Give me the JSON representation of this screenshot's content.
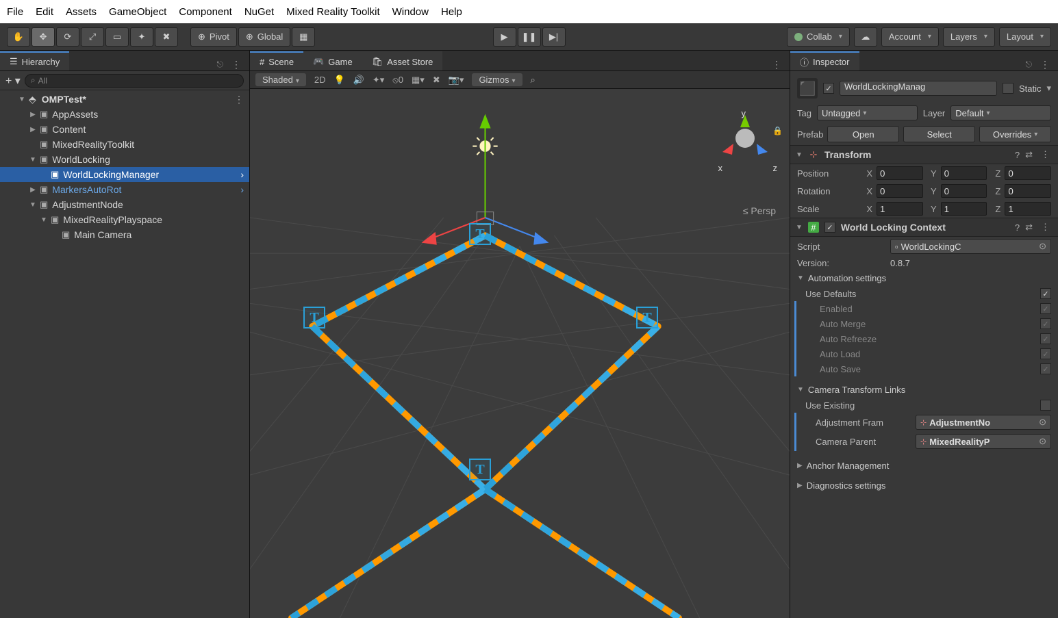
{
  "menubar": [
    "File",
    "Edit",
    "Assets",
    "GameObject",
    "Component",
    "NuGet",
    "Mixed Reality Toolkit",
    "Window",
    "Help"
  ],
  "toolbar": {
    "pivot": "Pivot",
    "global": "Global",
    "collab": "Collab",
    "account": "Account",
    "layers": "Layers",
    "layout": "Layout"
  },
  "hierarchy": {
    "title": "Hierarchy",
    "search_ph": "All",
    "scene": "OMPTest*",
    "items": {
      "appassets": "AppAssets",
      "content": "Content",
      "mrtk": "MixedRealityToolkit",
      "worldlocking": "WorldLocking",
      "wlm": "WorldLockingManager",
      "markers": "MarkersAutoRot",
      "adj": "AdjustmentNode",
      "playspace": "MixedRealityPlayspace",
      "camera": "Main Camera"
    }
  },
  "tabs": {
    "scene": "Scene",
    "game": "Game",
    "asset": "Asset Store",
    "inspector": "Inspector"
  },
  "scenebar": {
    "shaded": "Shaded",
    "twoD": "2D",
    "gizmos": "Gizmos"
  },
  "viewport": {
    "persp": "Persp",
    "x": "x",
    "y": "y",
    "z": "z"
  },
  "inspector": {
    "name": "WorldLockingManag",
    "static": "Static",
    "tag_l": "Tag",
    "tag_v": "Untagged",
    "layer_l": "Layer",
    "layer_v": "Default",
    "prefab_l": "Prefab",
    "open": "Open",
    "select": "Select",
    "overrides": "Overrides",
    "transform": {
      "title": "Transform",
      "position": "Position",
      "rotation": "Rotation",
      "scale": "Scale",
      "px": "0",
      "py": "0",
      "pz": "0",
      "rx": "0",
      "ry": "0",
      "rz": "0",
      "sx": "1",
      "sy": "1",
      "sz": "1",
      "X": "X",
      "Y": "Y",
      "Z": "Z"
    },
    "wlc": {
      "title": "World Locking Context",
      "script_l": "Script",
      "script_v": "WorldLockingC",
      "version_l": "Version:",
      "version_v": "0.8.7",
      "auto_h": "Automation settings",
      "use_defaults": "Use Defaults",
      "enabled": "Enabled",
      "auto_merge": "Auto Merge",
      "auto_refreeze": "Auto Refreeze",
      "auto_load": "Auto Load",
      "auto_save": "Auto Save",
      "cam_h": "Camera Transform Links",
      "use_existing": "Use Existing",
      "adj_l": "Adjustment Fram",
      "adj_v": "AdjustmentNo",
      "cam_l": "Camera Parent",
      "cam_v": "MixedRealityP",
      "anchor_h": "Anchor Management",
      "diag_h": "Diagnostics settings"
    }
  }
}
